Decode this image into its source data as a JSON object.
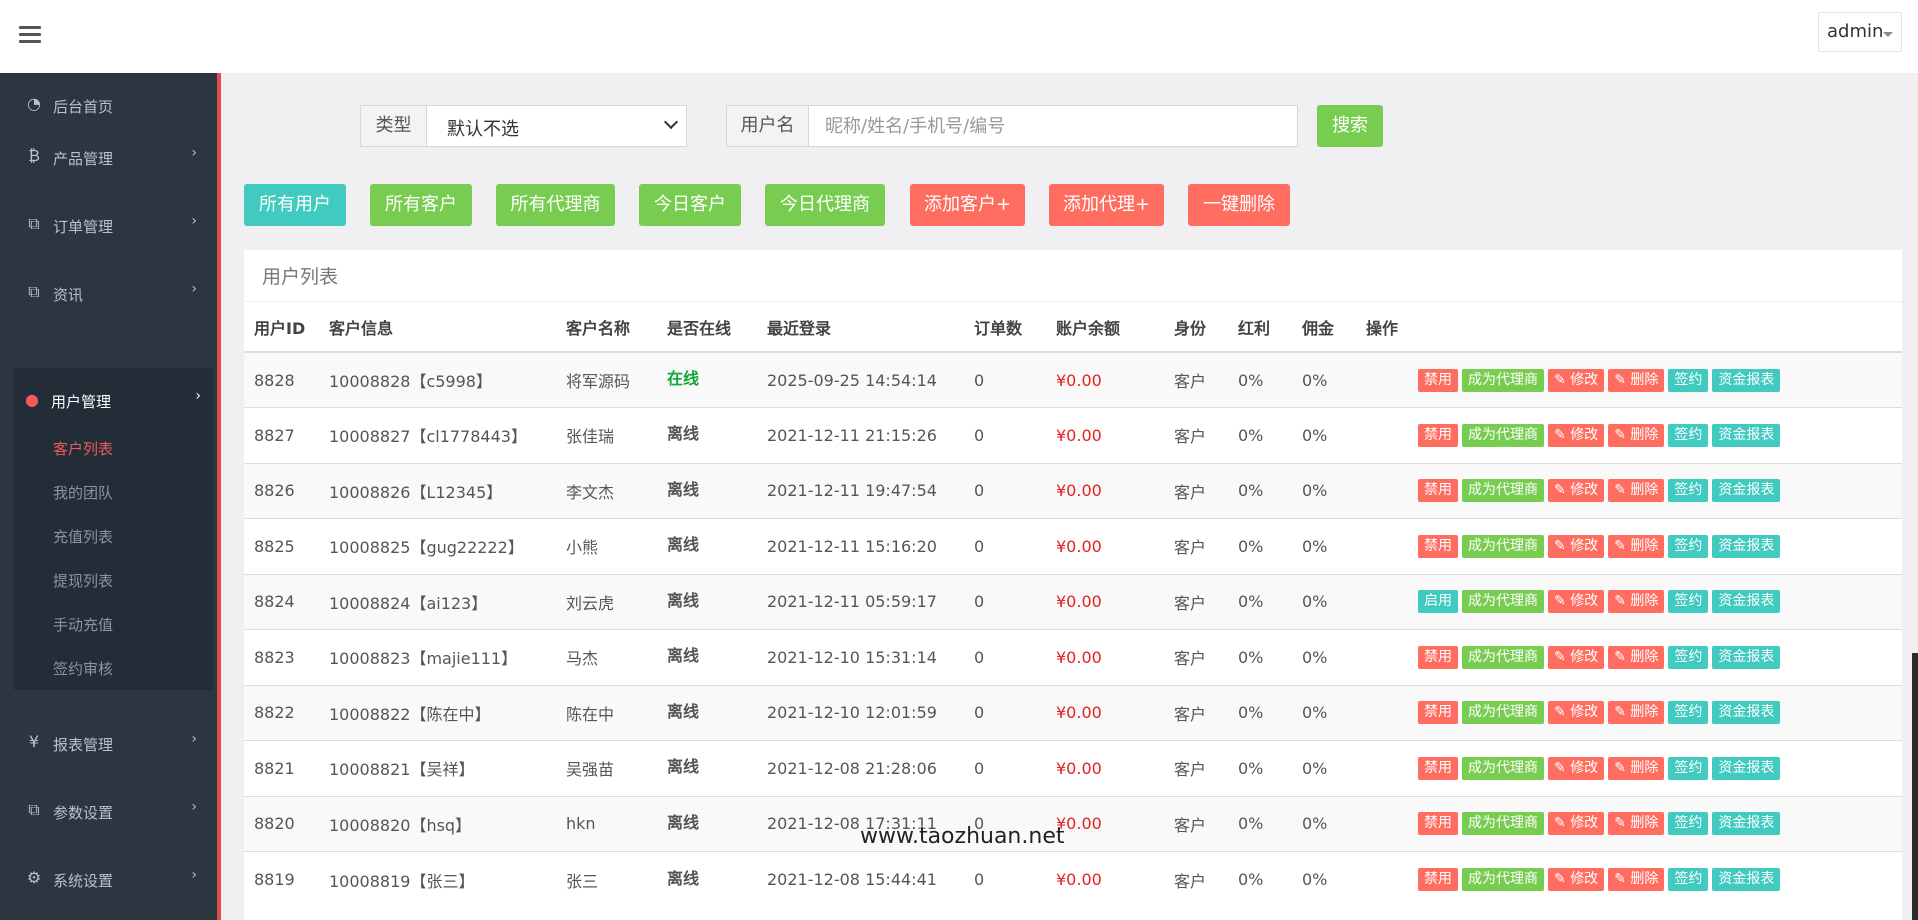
{
  "header": {
    "user": "admin"
  },
  "sidebar": {
    "items": [
      {
        "label": "后台首页",
        "icon": "dashboard-icon",
        "glyph": "◔",
        "arrow": false
      },
      {
        "label": "产品管理",
        "icon": "bitcoin-icon",
        "glyph": "₿",
        "arrow": true
      },
      {
        "label": "订单管理",
        "icon": "copy-icon",
        "glyph": "⧉",
        "arrow": true
      },
      {
        "label": "资讯",
        "icon": "copy-icon",
        "glyph": "⧉",
        "arrow": true
      }
    ],
    "active_group": {
      "label": "用户管理",
      "icon": "user-icon",
      "glyph": "●",
      "subitems": [
        {
          "label": "客户列表",
          "active": true
        },
        {
          "label": "我的团队",
          "active": false
        },
        {
          "label": "充值列表",
          "active": false
        },
        {
          "label": "提现列表",
          "active": false
        },
        {
          "label": "手动充值",
          "active": false
        },
        {
          "label": "签约审核",
          "active": false
        }
      ]
    },
    "items_after": [
      {
        "label": "报表管理",
        "icon": "yen-icon",
        "glyph": "¥",
        "arrow": true
      },
      {
        "label": "参数设置",
        "icon": "copy-icon",
        "glyph": "⧉",
        "arrow": true
      },
      {
        "label": "系统设置",
        "icon": "cogs-icon",
        "glyph": "⚙",
        "arrow": true
      }
    ]
  },
  "search": {
    "type_label": "类型",
    "type_value": "默认不选",
    "username_label": "用户名",
    "username_placeholder": "昵称/姓名/手机号/编号",
    "search_button": "搜索"
  },
  "filters": [
    {
      "label": "所有用户",
      "color": "#41cac0"
    },
    {
      "label": "所有客户",
      "color": "#78cd51"
    },
    {
      "label": "所有代理商",
      "color": "#78cd51"
    },
    {
      "label": "今日客户",
      "color": "#78cd51"
    },
    {
      "label": "今日代理商",
      "color": "#78cd51"
    },
    {
      "label": "添加客户+",
      "color": "#ff6c60"
    },
    {
      "label": "添加代理+",
      "color": "#ff6c60"
    },
    {
      "label": "一键删除",
      "color": "#ff6c60"
    }
  ],
  "panel": {
    "title": "用户列表"
  },
  "table": {
    "columns": [
      "用户ID",
      "客户信息",
      "客户名称",
      "是否在线",
      "最近登录",
      "订单数",
      "账户余额",
      "身份",
      "红利",
      "佣金",
      "操作"
    ],
    "actions": {
      "disable": "禁用",
      "enable": "启用",
      "agent": "成为代理商",
      "edit": "修改",
      "delete": "删除",
      "sign": "签约",
      "report": "资金报表"
    },
    "rows": [
      {
        "id": "8828",
        "info": "10008828【c5998】",
        "name": "将军源码",
        "online": "在线",
        "is_online": true,
        "last_login": "2025-09-25 14:54:14",
        "orders": "0",
        "balance": "¥0.00",
        "role": "客户",
        "bonus": "0%",
        "commission": "0%",
        "status_action": "禁用"
      },
      {
        "id": "8827",
        "info": "10008827【cl1778443】",
        "name": "张佳瑞",
        "online": "离线",
        "is_online": false,
        "last_login": "2021-12-11 21:15:26",
        "orders": "0",
        "balance": "¥0.00",
        "role": "客户",
        "bonus": "0%",
        "commission": "0%",
        "status_action": "禁用"
      },
      {
        "id": "8826",
        "info": "10008826【L12345】",
        "name": "李文杰",
        "online": "离线",
        "is_online": false,
        "last_login": "2021-12-11 19:47:54",
        "orders": "0",
        "balance": "¥0.00",
        "role": "客户",
        "bonus": "0%",
        "commission": "0%",
        "status_action": "禁用"
      },
      {
        "id": "8825",
        "info": "10008825【gug22222】",
        "name": "小熊",
        "online": "离线",
        "is_online": false,
        "last_login": "2021-12-11 15:16:20",
        "orders": "0",
        "balance": "¥0.00",
        "role": "客户",
        "bonus": "0%",
        "commission": "0%",
        "status_action": "禁用"
      },
      {
        "id": "8824",
        "info": "10008824【ai123】",
        "name": "刘云虎",
        "online": "离线",
        "is_online": false,
        "last_login": "2021-12-11 05:59:17",
        "orders": "0",
        "balance": "¥0.00",
        "role": "客户",
        "bonus": "0%",
        "commission": "0%",
        "status_action": "启用"
      },
      {
        "id": "8823",
        "info": "10008823【majie111】",
        "name": "马杰",
        "online": "离线",
        "is_online": false,
        "last_login": "2021-12-10 15:31:14",
        "orders": "0",
        "balance": "¥0.00",
        "role": "客户",
        "bonus": "0%",
        "commission": "0%",
        "status_action": "禁用"
      },
      {
        "id": "8822",
        "info": "10008822【陈在中】",
        "name": "陈在中",
        "online": "离线",
        "is_online": false,
        "last_login": "2021-12-10 12:01:59",
        "orders": "0",
        "balance": "¥0.00",
        "role": "客户",
        "bonus": "0%",
        "commission": "0%",
        "status_action": "禁用"
      },
      {
        "id": "8821",
        "info": "10008821【吴祥】",
        "name": "吴强苗",
        "online": "离线",
        "is_online": false,
        "last_login": "2021-12-08 21:28:06",
        "orders": "0",
        "balance": "¥0.00",
        "role": "客户",
        "bonus": "0%",
        "commission": "0%",
        "status_action": "禁用"
      },
      {
        "id": "8820",
        "info": "10008820【hsq】",
        "name": "hkn",
        "online": "离线",
        "is_online": false,
        "last_login": "2021-12-08 17:31:11",
        "orders": "0",
        "balance": "¥0.00",
        "role": "客户",
        "bonus": "0%",
        "commission": "0%",
        "status_action": "禁用"
      },
      {
        "id": "8819",
        "info": "10008819【张三】",
        "name": "张三",
        "online": "离线",
        "is_online": false,
        "last_login": "2021-12-08 15:44:41",
        "orders": "0",
        "balance": "¥0.00",
        "role": "客户",
        "bonus": "0%",
        "commission": "0%",
        "status_action": "禁用"
      }
    ]
  },
  "watermark": "www.taozhuan.net"
}
